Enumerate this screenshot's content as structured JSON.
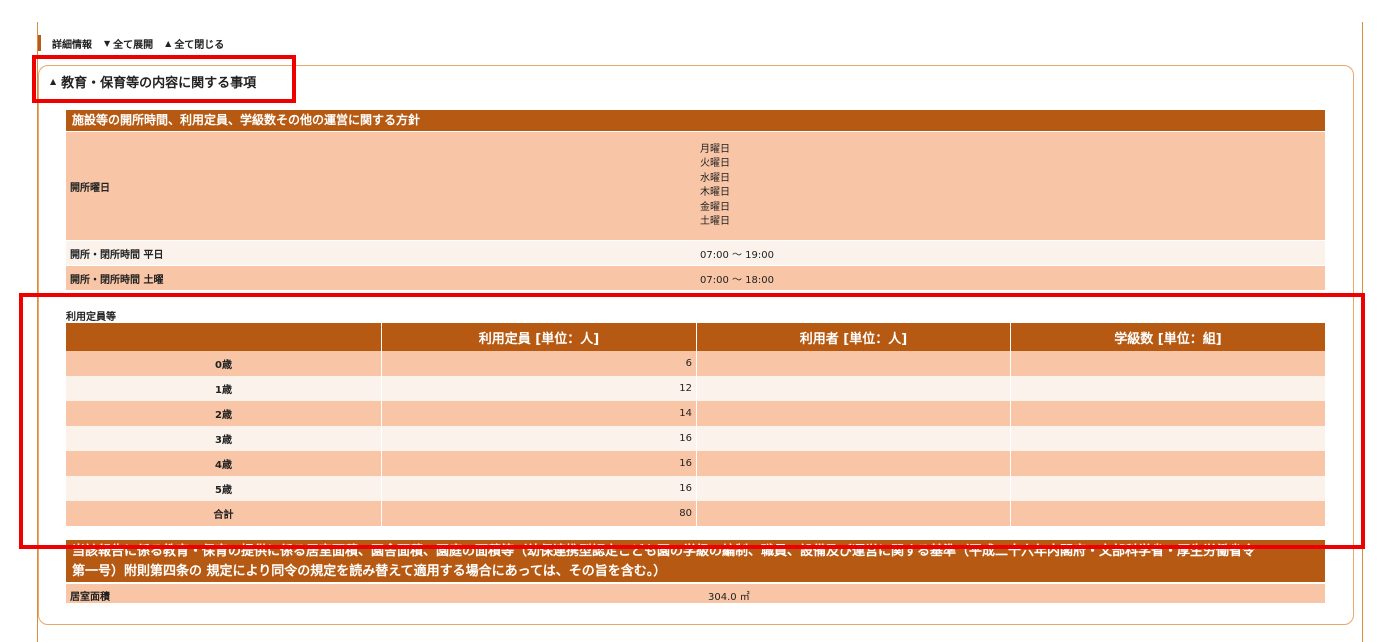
{
  "toolbar": {
    "title": "詳細情報",
    "expand_all": "全て展開",
    "collapse_all": "全て閉じる"
  },
  "section": {
    "title": "教育・保育等の内容に関する事項"
  },
  "policy": {
    "header": "施設等の開所時間、利用定員、学級数その他の運営に関する方針",
    "open_days_label": "開所曜日",
    "open_days": [
      "月曜日",
      "火曜日",
      "水曜日",
      "木曜日",
      "金曜日",
      "土曜日"
    ],
    "weekday_hours_label": "開所・閉所時間 平日",
    "weekday_hours": "07:00 〜 19:00",
    "saturday_hours_label": "開所・閉所時間 土曜",
    "saturday_hours": "07:00 〜 18:00"
  },
  "capacity": {
    "title": "利用定員等",
    "columns": [
      "",
      "利用定員 [単位：人]",
      "利用者 [単位：人]",
      "学級数 [単位：組]"
    ],
    "rows": [
      {
        "age": "0歳",
        "capacity": "6",
        "users": "",
        "classes": ""
      },
      {
        "age": "1歳",
        "capacity": "12",
        "users": "",
        "classes": ""
      },
      {
        "age": "2歳",
        "capacity": "14",
        "users": "",
        "classes": ""
      },
      {
        "age": "3歳",
        "capacity": "16",
        "users": "",
        "classes": ""
      },
      {
        "age": "4歳",
        "capacity": "16",
        "users": "",
        "classes": ""
      },
      {
        "age": "5歳",
        "capacity": "16",
        "users": "",
        "classes": ""
      },
      {
        "age": "合計",
        "capacity": "80",
        "users": "",
        "classes": ""
      }
    ]
  },
  "bottom": {
    "header_line1": "当該報告に係る教育・保育の提供に係る居室面積、園舎面積、園庭の面積等（幼保連携型認定こども園の学級の編制、職員、設備及び運営に関する基準（平成二十六年内閣府・文部科学省・厚生労働省令",
    "header_line2": "第一号）附則第四条の 規定により同令の規定を読み替えて適用する場合にあっては、その旨を含む。）",
    "row_label": "居室面積",
    "row_value": "304.0 ㎡"
  },
  "colors": {
    "header_bg": "#b65a13",
    "row_dark": "#f8c6a6",
    "row_light": "#fbf3eb",
    "highlight": "#ee0000"
  }
}
